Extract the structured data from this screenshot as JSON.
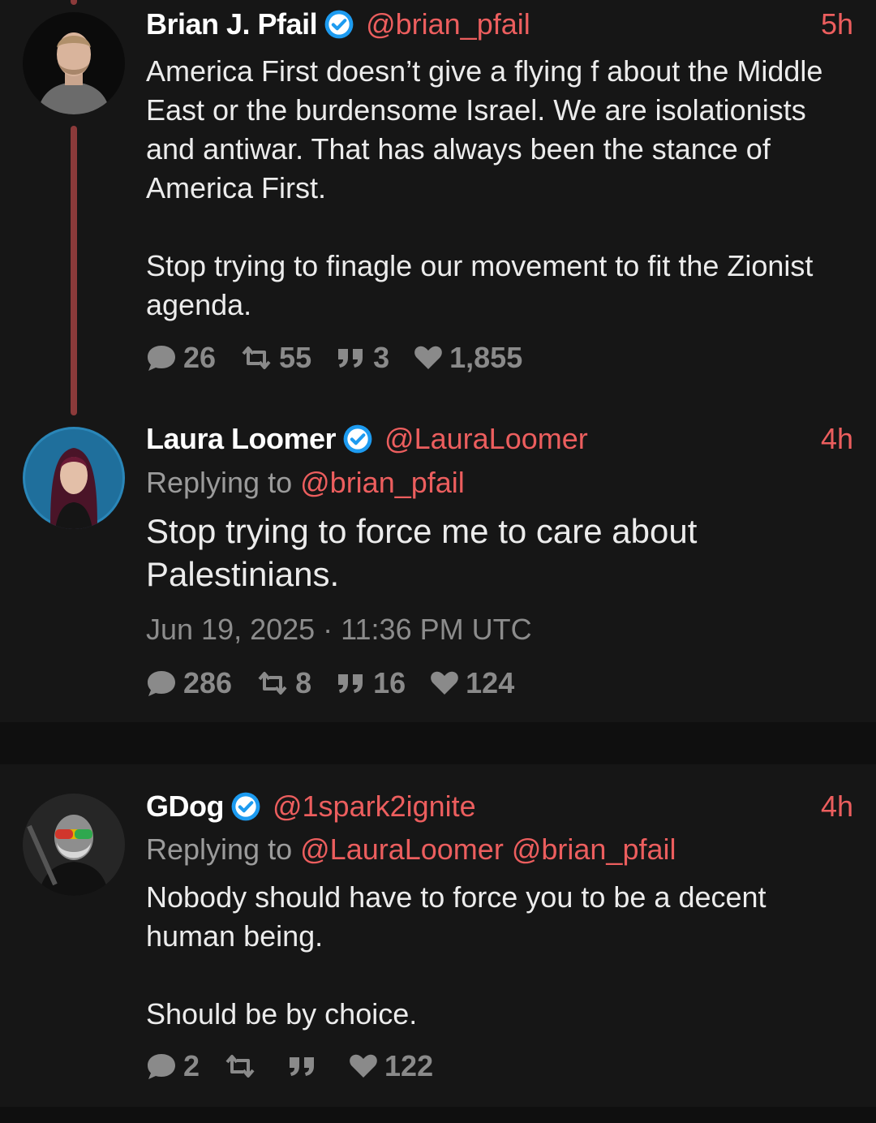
{
  "tweets": [
    {
      "name": "Brian J. Pfail",
      "handle": "@brian_pfail",
      "time": "5h",
      "body": [
        "America First doesn’t give a flying f about the Middle East or the burdensome Israel. We are isolationists and antiwar. That has always been the stance of America First.",
        "Stop trying to finagle our movement to fit the Zionist agenda."
      ],
      "stats": {
        "replies": "26",
        "retweets": "55",
        "quotes": "3",
        "likes": "1,855"
      }
    },
    {
      "name": "Laura Loomer",
      "handle": "@LauraLoomer",
      "time": "4h",
      "replying_label": "Replying to",
      "replying_to": [
        "@brian_pfail"
      ],
      "body": [
        "Stop trying to force me to care about Palestinians."
      ],
      "date": "Jun 19, 2025 · 11:36 PM UTC",
      "stats": {
        "replies": "286",
        "retweets": "8",
        "quotes": "16",
        "likes": "124"
      }
    },
    {
      "name": "GDog",
      "handle": "@1spark2ignite",
      "time": "4h",
      "replying_label": "Replying to",
      "replying_to": [
        "@LauraLoomer",
        "@brian_pfail"
      ],
      "body": [
        "Nobody should have to force you to be a decent human being.",
        "Should be by choice."
      ],
      "stats": {
        "replies": "2",
        "retweets": "",
        "quotes": "",
        "likes": "122"
      }
    }
  ],
  "colors": {
    "background": "#161616",
    "separator": "#0f0f0f",
    "accent": "#ec5e5e",
    "thread_line": "#8b3a3a",
    "verified": "#1d9bf0",
    "muted": "#8a8a8a"
  },
  "icons": {
    "verified": "verified-badge-icon",
    "reply": "comment-icon",
    "retweet": "retweet-icon",
    "quote": "quote-icon",
    "like": "heart-icon"
  }
}
